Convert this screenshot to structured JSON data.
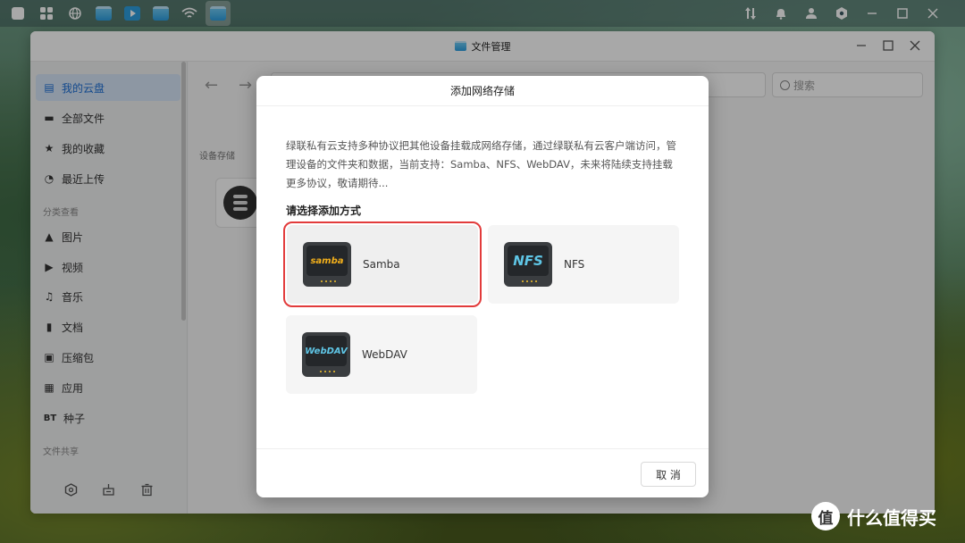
{
  "taskbar": {
    "icons": [
      "home-icon",
      "apps-icon",
      "globe-icon",
      "file-app-icon",
      "video-app-icon",
      "folder-app-icon",
      "wifi-icon",
      "file-manager-icon"
    ],
    "right_icons": [
      "sort-icon",
      "bell-icon",
      "user-icon",
      "settings-icon",
      "minimize-icon",
      "maximize-icon",
      "close-icon"
    ]
  },
  "window": {
    "title": "文件管理"
  },
  "sidebar": {
    "items": [
      {
        "label": "我的云盘",
        "icon": "cloud-drive-icon"
      },
      {
        "label": "全部文件",
        "icon": "folder-icon"
      },
      {
        "label": "我的收藏",
        "icon": "star-icon"
      },
      {
        "label": "最近上传",
        "icon": "clock-icon"
      },
      {
        "label": "图片",
        "icon": "image-icon"
      },
      {
        "label": "视频",
        "icon": "video-icon"
      },
      {
        "label": "音乐",
        "icon": "headphones-icon"
      },
      {
        "label": "文档",
        "icon": "document-icon"
      },
      {
        "label": "压缩包",
        "icon": "archive-icon"
      },
      {
        "label": "应用",
        "icon": "apps-grid-icon"
      },
      {
        "label": "种子",
        "icon": "bt-icon",
        "icon_text": "BT"
      }
    ],
    "section_category": "分类查看",
    "section_share": "文件共享"
  },
  "toolbar": {
    "search_placeholder": "搜索"
  },
  "content": {
    "section_label": "设备存储"
  },
  "dialog": {
    "title": "添加网络存储",
    "description": "绿联私有云支持多种协议把其他设备挂载成网络存储，通过绿联私有云客户端访问，管理设备的文件夹和数据，当前支持：Samba、NFS、WebDAV，未来将陆续支持挂载更多协议，敬请期待...",
    "subtitle": "请选择添加方式",
    "options": [
      {
        "label": "Samba",
        "logo": "samba",
        "selected": true
      },
      {
        "label": "NFS",
        "logo": "NFS",
        "selected": false
      },
      {
        "label": "WebDAV",
        "logo": "WebDAV",
        "selected": false
      }
    ],
    "cancel_label": "取 消"
  },
  "watermark": {
    "text": "什么值得买",
    "badge": "值"
  },
  "colors": {
    "accent": "#1d6fd6",
    "selection_outline": "#e23b3b",
    "samba_logo": "#f3b01b",
    "nfs_logo": "#5fc6e6",
    "webdav_logo": "#5fc6e6"
  }
}
